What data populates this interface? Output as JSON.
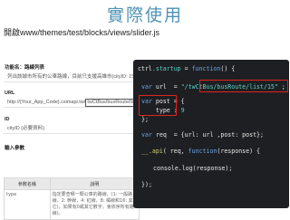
{
  "slide": {
    "title": "實際使用",
    "subtitle": "開啟www/themes/test/blocks/views/slider.js"
  },
  "doc": {
    "function_label": "功能名：路線列表",
    "function_desc": "列出該城市所有的公車路線，目前只支援高雄市(cityID: 15)。",
    "url_label": "URL",
    "url_prefix": "http://{Your_App_Code}.csimapi.tw/",
    "url_highlight": "twCtBus/busRoute/list/",
    "url_suffix": "ID",
    "id_label": "ID",
    "id_desc": "cityID (必要資料)",
    "input_label": "輸入參數",
    "table": {
      "headers": [
        "參數名稱",
        "說明"
      ],
      "rows": [
        {
          "name": "type",
          "desc": "指定要查哪一類公車的路線，(1: 一般路線，2: 幹線，4: 紅線，8: 橘線和16: 其它)，如果有0或其它數字，會依序所有路線)。"
        }
      ]
    }
  },
  "code": {
    "line1": {
      "obj": "ctrl",
      "prop": ".startup",
      "eq": " = ",
      "kw": "function",
      "rest": "() {"
    },
    "line2": {
      "kw": "var",
      "rest1": " url  = ",
      "str": "\"/twCtBus/busRoute/list/15\"",
      "rest2": " ;"
    },
    "line3": {
      "kw": "var",
      "rest": " post = {"
    },
    "line4": {
      "text": "    type : ",
      "num": "9"
    },
    "line5": {
      "text": "};"
    },
    "line6": {
      "kw": "var",
      "rest1": " req  = {url: url ,post: post};"
    },
    "line7": {
      "f": "__.api",
      "rest1": "( req, ",
      "kw": "function",
      "rest2": "(response) {"
    },
    "line8": {
      "text": "console.log(response);"
    },
    "line9": {
      "text": "});"
    }
  }
}
